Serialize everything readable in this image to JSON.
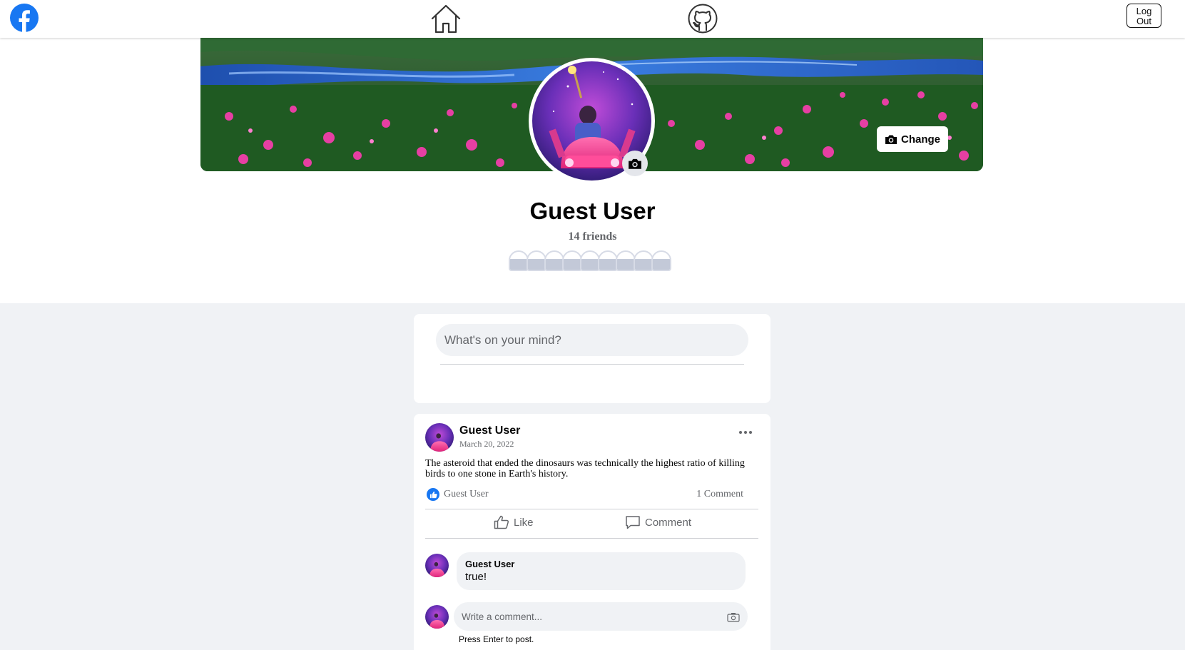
{
  "nav": {
    "logout_label_line1": "Log",
    "logout_label_line2": "Out",
    "brand_color": "#1877f2"
  },
  "icons": {
    "logo": "facebook-logo-icon",
    "home": "home-icon",
    "github": "github-icon",
    "camera": "camera-icon",
    "more": "more-dots-icon",
    "like": "thumbs-up-icon",
    "comment": "comment-icon"
  },
  "profile": {
    "change_cover_label": "Change",
    "name": "Guest User",
    "friends_count": "14 friends"
  },
  "composer": {
    "placeholder": "What's on your mind?"
  },
  "post": {
    "author": "Guest User",
    "date": "March 20, 2022",
    "text": "The asteroid that ended the dinosaurs was technically the highest ratio of killing birds to one stone in Earth's history.",
    "liked_by": "Guest User",
    "comment_count": "1 Comment",
    "like_label": "Like",
    "comment_label": "Comment",
    "comments": [
      {
        "author": "Guest User",
        "text": "true!"
      }
    ],
    "write_comment_placeholder": "Write a comment...",
    "press_enter_hint": "Press Enter to post."
  }
}
